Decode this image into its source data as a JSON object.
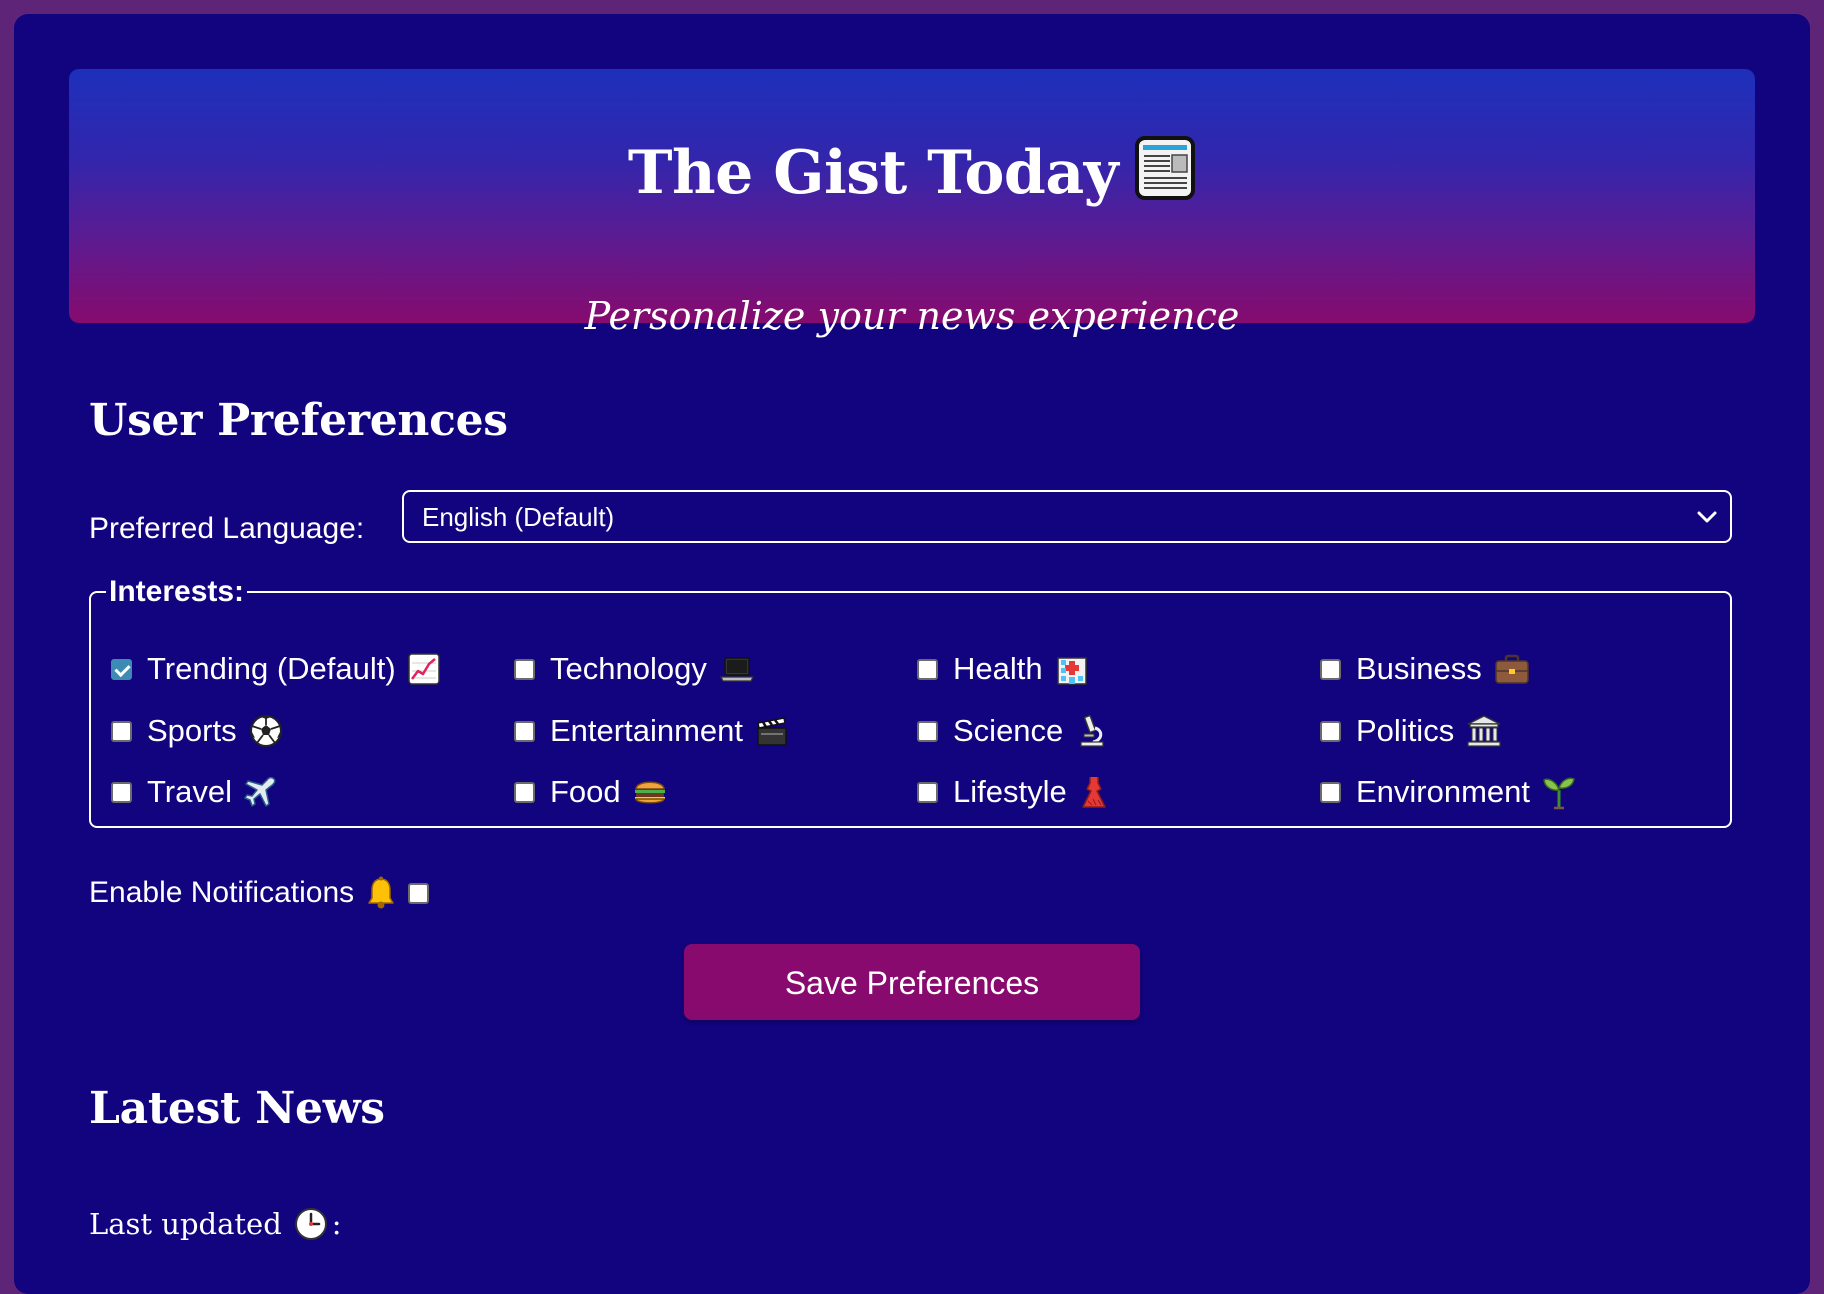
{
  "header": {
    "title": "The Gist Today",
    "title_icon": "newspaper-icon",
    "tagline": "Personalize your news experience"
  },
  "preferences": {
    "heading": "User Preferences",
    "language_label": "Preferred Language:",
    "language_value": "English (Default)",
    "interests_legend": "Interests:",
    "interests": [
      {
        "label": "Trending (Default)",
        "icon": "chart-increasing-icon",
        "checked": true
      },
      {
        "label": "Technology",
        "icon": "laptop-icon",
        "checked": false
      },
      {
        "label": "Health",
        "icon": "hospital-icon",
        "checked": false
      },
      {
        "label": "Business",
        "icon": "briefcase-icon",
        "checked": false
      },
      {
        "label": "Sports",
        "icon": "soccer-ball-icon",
        "checked": false
      },
      {
        "label": "Entertainment",
        "icon": "clapper-board-icon",
        "checked": false
      },
      {
        "label": "Science",
        "icon": "microscope-icon",
        "checked": false
      },
      {
        "label": "Politics",
        "icon": "classical-building-icon",
        "checked": false
      },
      {
        "label": "Travel",
        "icon": "airplane-icon",
        "checked": false
      },
      {
        "label": "Food",
        "icon": "hamburger-icon",
        "checked": false
      },
      {
        "label": "Lifestyle",
        "icon": "dress-icon",
        "checked": false
      },
      {
        "label": "Environment",
        "icon": "seedling-icon",
        "checked": false
      }
    ],
    "notifications_label": "Enable Notifications",
    "notifications_icon": "bell-icon",
    "notifications_enabled": false,
    "save_label": "Save Preferences"
  },
  "news": {
    "heading": "Latest News",
    "last_updated_label": "Last updated",
    "last_updated_icon": "clock-icon",
    "last_updated_suffix": ":"
  },
  "colors": {
    "page_border": "#5e2477",
    "background": "#12037f",
    "header_top": "#1d30bb",
    "header_bottom": "#860b6e",
    "button": "#890a6e",
    "checkbox_checked": "#3d8bb5"
  }
}
